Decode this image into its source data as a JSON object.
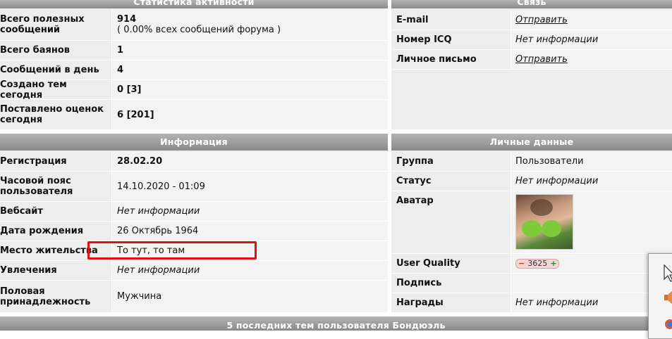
{
  "activity": {
    "title": "Статистика активности",
    "rows": [
      {
        "label": "Всего полезных сообщений",
        "value": "914",
        "sub": "( 0.00% всех сообщений форума )"
      },
      {
        "label": "Всего баянов",
        "value": "1"
      },
      {
        "label": "Сообщений в день",
        "value": "4"
      },
      {
        "label": "Создано тем сегодня",
        "value": "0 [3]"
      },
      {
        "label": "Поставлено оценок сегодня",
        "value": "6 [201]"
      }
    ]
  },
  "contact": {
    "title": "Связь",
    "rows": [
      {
        "label": "E-mail",
        "value": "Отправить"
      },
      {
        "label": "Номер ICQ",
        "value": "Нет информации"
      },
      {
        "label": "Личное письмо",
        "value": "Отправить"
      }
    ]
  },
  "info": {
    "title": "Информация",
    "rows": [
      {
        "label": "Регистрация",
        "value": "28.02.20"
      },
      {
        "label": "Часовой пояс пользователя",
        "value": "14.10.2020 - 01:09"
      },
      {
        "label": "Вебсайт",
        "value": "Нет информации"
      },
      {
        "label": "Дата рождения",
        "value": "26 Октябрь 1964"
      },
      {
        "label": "Место жительства",
        "value": "То тут, то там"
      },
      {
        "label": "Увлечения",
        "value": "Нет информации"
      },
      {
        "label": "Половая принадлежность",
        "value": "Мужчина"
      }
    ]
  },
  "personal": {
    "title": "Личные данные",
    "rows": [
      {
        "label": "Группа",
        "value": "Пользователи"
      },
      {
        "label": "Статус",
        "value": "Нет информации"
      },
      {
        "label": "Аватар",
        "value": ""
      },
      {
        "label": "User Quality",
        "value": "3625"
      },
      {
        "label": "Подпись",
        "value": ""
      },
      {
        "label": "Награды",
        "value": "Нет информации"
      }
    ]
  },
  "bottom": {
    "title": "5 последних тем пользователя Бондюэль"
  },
  "colors": {
    "highlight": "#e01010",
    "header": "#9a9a9a"
  }
}
